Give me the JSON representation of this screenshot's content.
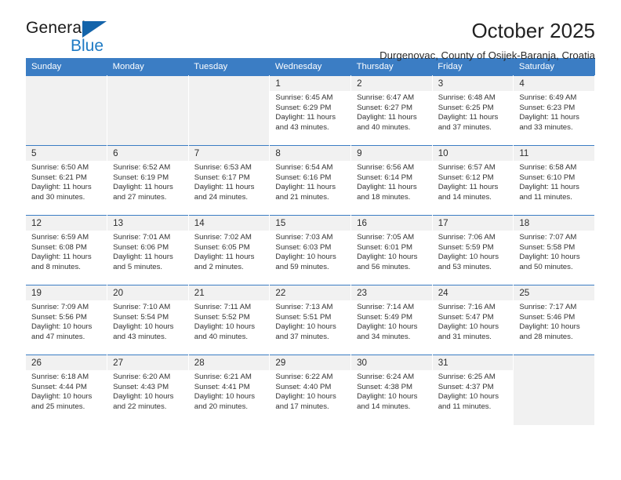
{
  "brand": {
    "name_top": "General",
    "name_bottom": "Blue",
    "triangle_color": "#1464aa",
    "blue_color": "#1e7ac4"
  },
  "header": {
    "title": "October 2025",
    "subtitle": "Durgenovac, County of Osijek-Baranja, Croatia"
  },
  "theme": {
    "header_row_bg": "#3b7dc4",
    "daynum_bg": "#f1f1f1",
    "text": "#333333"
  },
  "labels": {
    "sunrise_prefix": "Sunrise:",
    "sunset_prefix": "Sunset:",
    "daylight_prefix": "Daylight:"
  },
  "weekdays": [
    "Sunday",
    "Monday",
    "Tuesday",
    "Wednesday",
    "Thursday",
    "Friday",
    "Saturday"
  ],
  "weeks": [
    [
      {
        "day": "",
        "blank": true
      },
      {
        "day": "",
        "blank": true
      },
      {
        "day": "",
        "blank": true
      },
      {
        "day": "1",
        "sunrise": "Sunrise: 6:45 AM",
        "sunset": "Sunset: 6:29 PM",
        "daylight_1": "Daylight: 11 hours",
        "daylight_2": "and 43 minutes."
      },
      {
        "day": "2",
        "sunrise": "Sunrise: 6:47 AM",
        "sunset": "Sunset: 6:27 PM",
        "daylight_1": "Daylight: 11 hours",
        "daylight_2": "and 40 minutes."
      },
      {
        "day": "3",
        "sunrise": "Sunrise: 6:48 AM",
        "sunset": "Sunset: 6:25 PM",
        "daylight_1": "Daylight: 11 hours",
        "daylight_2": "and 37 minutes."
      },
      {
        "day": "4",
        "sunrise": "Sunrise: 6:49 AM",
        "sunset": "Sunset: 6:23 PM",
        "daylight_1": "Daylight: 11 hours",
        "daylight_2": "and 33 minutes."
      }
    ],
    [
      {
        "day": "5",
        "sunrise": "Sunrise: 6:50 AM",
        "sunset": "Sunset: 6:21 PM",
        "daylight_1": "Daylight: 11 hours",
        "daylight_2": "and 30 minutes."
      },
      {
        "day": "6",
        "sunrise": "Sunrise: 6:52 AM",
        "sunset": "Sunset: 6:19 PM",
        "daylight_1": "Daylight: 11 hours",
        "daylight_2": "and 27 minutes."
      },
      {
        "day": "7",
        "sunrise": "Sunrise: 6:53 AM",
        "sunset": "Sunset: 6:17 PM",
        "daylight_1": "Daylight: 11 hours",
        "daylight_2": "and 24 minutes."
      },
      {
        "day": "8",
        "sunrise": "Sunrise: 6:54 AM",
        "sunset": "Sunset: 6:16 PM",
        "daylight_1": "Daylight: 11 hours",
        "daylight_2": "and 21 minutes."
      },
      {
        "day": "9",
        "sunrise": "Sunrise: 6:56 AM",
        "sunset": "Sunset: 6:14 PM",
        "daylight_1": "Daylight: 11 hours",
        "daylight_2": "and 18 minutes."
      },
      {
        "day": "10",
        "sunrise": "Sunrise: 6:57 AM",
        "sunset": "Sunset: 6:12 PM",
        "daylight_1": "Daylight: 11 hours",
        "daylight_2": "and 14 minutes."
      },
      {
        "day": "11",
        "sunrise": "Sunrise: 6:58 AM",
        "sunset": "Sunset: 6:10 PM",
        "daylight_1": "Daylight: 11 hours",
        "daylight_2": "and 11 minutes."
      }
    ],
    [
      {
        "day": "12",
        "sunrise": "Sunrise: 6:59 AM",
        "sunset": "Sunset: 6:08 PM",
        "daylight_1": "Daylight: 11 hours",
        "daylight_2": "and 8 minutes."
      },
      {
        "day": "13",
        "sunrise": "Sunrise: 7:01 AM",
        "sunset": "Sunset: 6:06 PM",
        "daylight_1": "Daylight: 11 hours",
        "daylight_2": "and 5 minutes."
      },
      {
        "day": "14",
        "sunrise": "Sunrise: 7:02 AM",
        "sunset": "Sunset: 6:05 PM",
        "daylight_1": "Daylight: 11 hours",
        "daylight_2": "and 2 minutes."
      },
      {
        "day": "15",
        "sunrise": "Sunrise: 7:03 AM",
        "sunset": "Sunset: 6:03 PM",
        "daylight_1": "Daylight: 10 hours",
        "daylight_2": "and 59 minutes."
      },
      {
        "day": "16",
        "sunrise": "Sunrise: 7:05 AM",
        "sunset": "Sunset: 6:01 PM",
        "daylight_1": "Daylight: 10 hours",
        "daylight_2": "and 56 minutes."
      },
      {
        "day": "17",
        "sunrise": "Sunrise: 7:06 AM",
        "sunset": "Sunset: 5:59 PM",
        "daylight_1": "Daylight: 10 hours",
        "daylight_2": "and 53 minutes."
      },
      {
        "day": "18",
        "sunrise": "Sunrise: 7:07 AM",
        "sunset": "Sunset: 5:58 PM",
        "daylight_1": "Daylight: 10 hours",
        "daylight_2": "and 50 minutes."
      }
    ],
    [
      {
        "day": "19",
        "sunrise": "Sunrise: 7:09 AM",
        "sunset": "Sunset: 5:56 PM",
        "daylight_1": "Daylight: 10 hours",
        "daylight_2": "and 47 minutes."
      },
      {
        "day": "20",
        "sunrise": "Sunrise: 7:10 AM",
        "sunset": "Sunset: 5:54 PM",
        "daylight_1": "Daylight: 10 hours",
        "daylight_2": "and 43 minutes."
      },
      {
        "day": "21",
        "sunrise": "Sunrise: 7:11 AM",
        "sunset": "Sunset: 5:52 PM",
        "daylight_1": "Daylight: 10 hours",
        "daylight_2": "and 40 minutes."
      },
      {
        "day": "22",
        "sunrise": "Sunrise: 7:13 AM",
        "sunset": "Sunset: 5:51 PM",
        "daylight_1": "Daylight: 10 hours",
        "daylight_2": "and 37 minutes."
      },
      {
        "day": "23",
        "sunrise": "Sunrise: 7:14 AM",
        "sunset": "Sunset: 5:49 PM",
        "daylight_1": "Daylight: 10 hours",
        "daylight_2": "and 34 minutes."
      },
      {
        "day": "24",
        "sunrise": "Sunrise: 7:16 AM",
        "sunset": "Sunset: 5:47 PM",
        "daylight_1": "Daylight: 10 hours",
        "daylight_2": "and 31 minutes."
      },
      {
        "day": "25",
        "sunrise": "Sunrise: 7:17 AM",
        "sunset": "Sunset: 5:46 PM",
        "daylight_1": "Daylight: 10 hours",
        "daylight_2": "and 28 minutes."
      }
    ],
    [
      {
        "day": "26",
        "sunrise": "Sunrise: 6:18 AM",
        "sunset": "Sunset: 4:44 PM",
        "daylight_1": "Daylight: 10 hours",
        "daylight_2": "and 25 minutes."
      },
      {
        "day": "27",
        "sunrise": "Sunrise: 6:20 AM",
        "sunset": "Sunset: 4:43 PM",
        "daylight_1": "Daylight: 10 hours",
        "daylight_2": "and 22 minutes."
      },
      {
        "day": "28",
        "sunrise": "Sunrise: 6:21 AM",
        "sunset": "Sunset: 4:41 PM",
        "daylight_1": "Daylight: 10 hours",
        "daylight_2": "and 20 minutes."
      },
      {
        "day": "29",
        "sunrise": "Sunrise: 6:22 AM",
        "sunset": "Sunset: 4:40 PM",
        "daylight_1": "Daylight: 10 hours",
        "daylight_2": "and 17 minutes."
      },
      {
        "day": "30",
        "sunrise": "Sunrise: 6:24 AM",
        "sunset": "Sunset: 4:38 PM",
        "daylight_1": "Daylight: 10 hours",
        "daylight_2": "and 14 minutes."
      },
      {
        "day": "31",
        "sunrise": "Sunrise: 6:25 AM",
        "sunset": "Sunset: 4:37 PM",
        "daylight_1": "Daylight: 10 hours",
        "daylight_2": "and 11 minutes."
      },
      {
        "day": "",
        "blank": true
      }
    ]
  ]
}
